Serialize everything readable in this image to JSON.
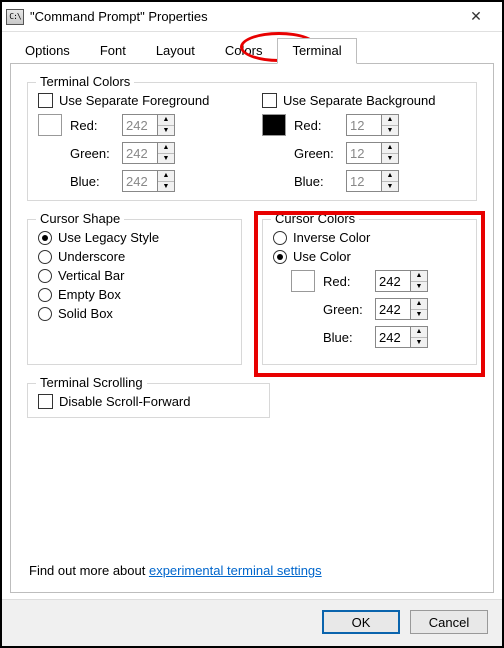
{
  "window": {
    "title": "\"Command Prompt\" Properties",
    "close_glyph": "✕",
    "icon_text": "C:\\"
  },
  "tabs": {
    "options": "Options",
    "font": "Font",
    "layout": "Layout",
    "colors": "Colors",
    "terminal": "Terminal"
  },
  "terminal_colors": {
    "legend": "Terminal Colors",
    "fg_cb": "Use Separate Foreground",
    "bg_cb": "Use Separate Background",
    "red_label": "Red:",
    "green_label": "Green:",
    "blue_label": "Blue:",
    "fg": {
      "r": "242",
      "g": "242",
      "b": "242"
    },
    "bg": {
      "r": "12",
      "g": "12",
      "b": "12"
    }
  },
  "cursor_shape": {
    "legend": "Cursor Shape",
    "legacy": "Use Legacy Style",
    "underscore": "Underscore",
    "vbar": "Vertical Bar",
    "empty": "Empty Box",
    "solid": "Solid Box"
  },
  "cursor_colors": {
    "legend": "Cursor Colors",
    "inverse": "Inverse Color",
    "use_color": "Use Color",
    "red_label": "Red:",
    "green_label": "Green:",
    "blue_label": "Blue:",
    "r": "242",
    "g": "242",
    "b": "242"
  },
  "scrolling": {
    "legend": "Terminal Scrolling",
    "disable": "Disable Scroll-Forward"
  },
  "link": {
    "prefix": "Find out more about ",
    "text": "experimental terminal settings"
  },
  "buttons": {
    "ok": "OK",
    "cancel": "Cancel"
  }
}
